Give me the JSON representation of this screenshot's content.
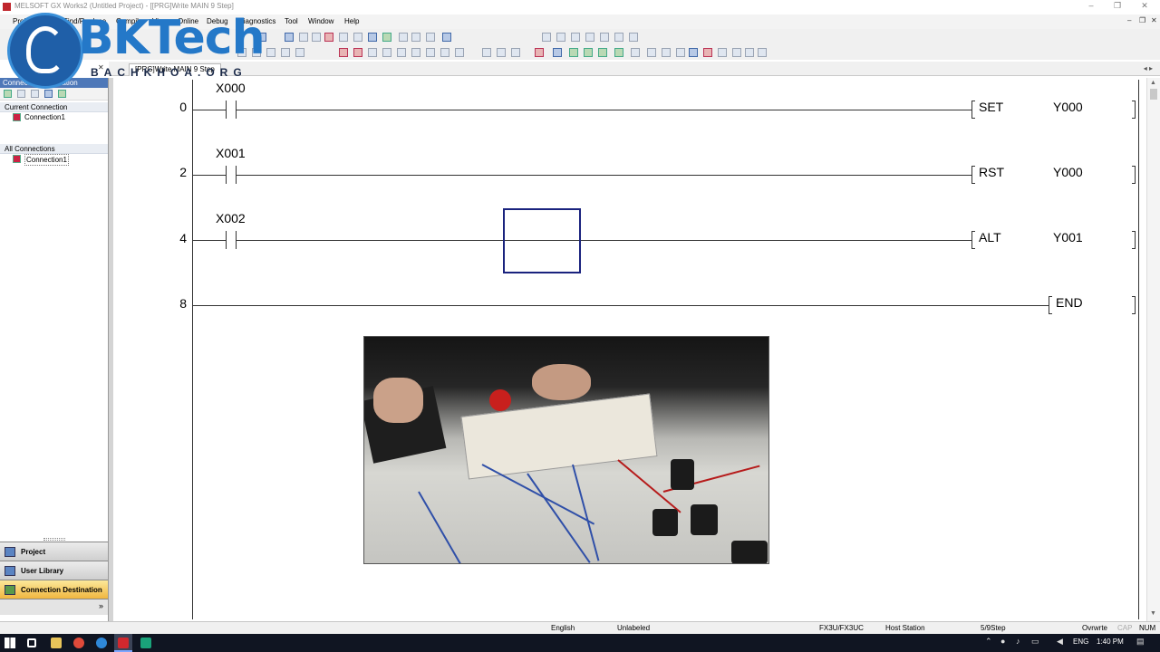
{
  "window": {
    "title": "MELSOFT GX Works2 (Untitled Project) - [[PRG]Write MAIN 9 Step]",
    "controls": [
      "–",
      "❐",
      "✕"
    ],
    "mdi_controls": [
      "–",
      "❐",
      "✕"
    ]
  },
  "menu": {
    "items": [
      "Project",
      "Edit",
      "Find/Replace",
      "Compile",
      "View",
      "Online",
      "Debug",
      "Diagnostics",
      "Tool",
      "Window",
      "Help"
    ]
  },
  "tab": {
    "label": "[PRG]Write MAIN 9 Step",
    "pin": "✕",
    "nav": "◂ ▸"
  },
  "sidebar": {
    "header": "Connection Destination",
    "groups": [
      {
        "title": "Current Connection",
        "items": [
          {
            "label": "Connection1"
          }
        ]
      },
      {
        "title": "All Connections",
        "items": [
          {
            "label": "Connection1"
          }
        ]
      }
    ],
    "nav": [
      {
        "label": "Project",
        "active": false
      },
      {
        "label": "User Library",
        "active": false
      },
      {
        "label": "Connection Destination",
        "active": true
      }
    ],
    "more": "»"
  },
  "ladder": {
    "rungs": [
      {
        "step": "0",
        "contact": "X000",
        "instr": "SET",
        "operand": "Y000"
      },
      {
        "step": "2",
        "contact": "X001",
        "instr": "RST",
        "operand": "Y000"
      },
      {
        "step": "4",
        "contact": "X002",
        "instr": "ALT",
        "operand": "Y001"
      },
      {
        "step": "8",
        "contact": "",
        "instr": "END",
        "operand": ""
      }
    ]
  },
  "status": {
    "language": "English",
    "label": "Unlabeled",
    "plc": "FX3U/FX3UC",
    "station": "Host Station",
    "steps": "5/9Step",
    "mode": "Ovrwrte",
    "cap": "CAP",
    "num": "NUM"
  },
  "taskbar": {
    "lang": "ENG",
    "time": "1:40 PM"
  },
  "watermark": {
    "brand": "BKTech",
    "sub": "BACHKHOA.ORG"
  },
  "colors": {
    "accent_nav_active": "#f0b640",
    "sidebar_header": "#4e78b8",
    "cursor": "#1a237e"
  }
}
